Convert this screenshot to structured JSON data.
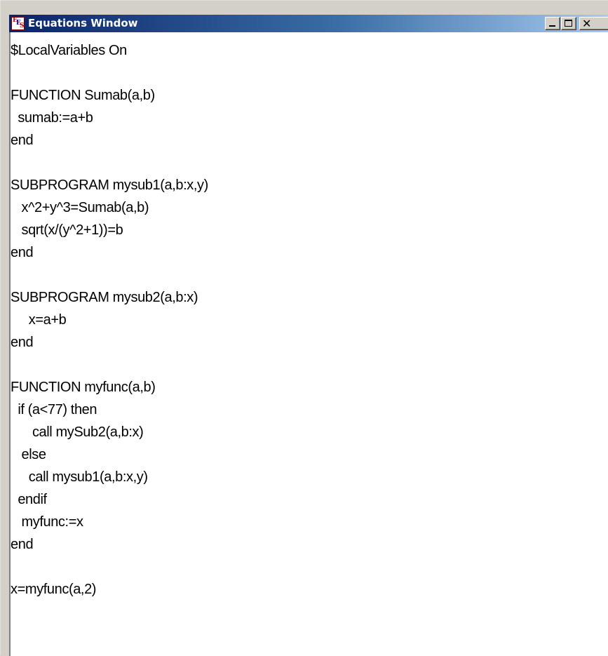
{
  "window": {
    "title": "Equations Window",
    "app_icon": "ees-app-icon",
    "controls": {
      "minimize": "minimize-icon",
      "maximize": "maximize-icon",
      "close": "close-icon"
    }
  },
  "editor": {
    "lines": [
      "$LocalVariables On",
      "",
      "FUNCTION Sumab(a,b)",
      "  sumab:=a+b",
      "end",
      "",
      "SUBPROGRAM mysub1(a,b:x,y)",
      "   x^2+y^3=Sumab(a,b)",
      "   sqrt(x/(y^2+1))=b",
      "end",
      "",
      "SUBPROGRAM mysub2(a,b:x)",
      "     x=a+b",
      "end",
      "",
      "FUNCTION myfunc(a,b)",
      "  if (a<77) then",
      "      call mySub2(a,b:x)",
      "   else",
      "     call mysub1(a,b:x,y)",
      "  endif",
      "   myfunc:=x",
      "end",
      "",
      "x=myfunc(a,2)"
    ]
  }
}
